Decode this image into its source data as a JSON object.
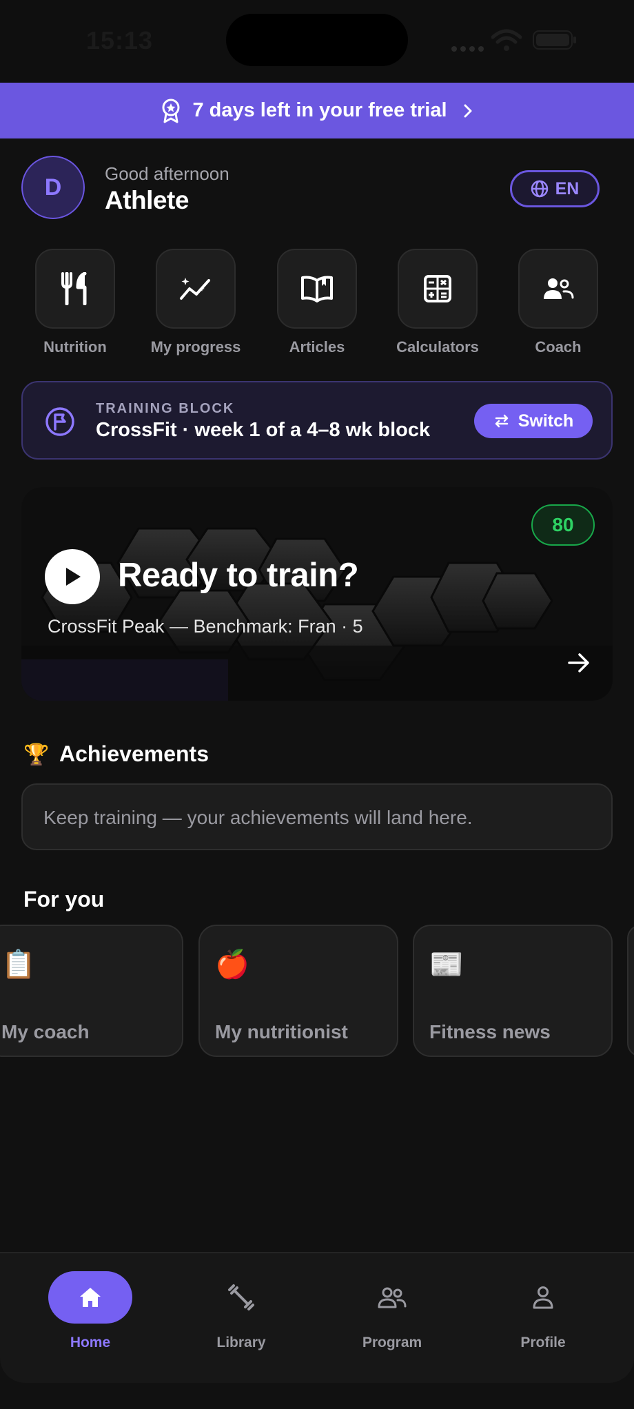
{
  "status_bar": {
    "time": "15:13"
  },
  "trial_banner": {
    "text": "7 days left in your free trial"
  },
  "greeting": {
    "avatar_letter": "D",
    "subtitle": "Good afternoon",
    "name": "Athlete",
    "language": "EN"
  },
  "quick_actions": [
    {
      "label": "Nutrition",
      "icon": "fork-knife-icon"
    },
    {
      "label": "My progress",
      "icon": "progress-chart-icon"
    },
    {
      "label": "Articles",
      "icon": "open-book-icon"
    },
    {
      "label": "Calculators",
      "icon": "calculator-icon"
    },
    {
      "label": "Coach",
      "icon": "coach-people-icon"
    }
  ],
  "training_block": {
    "label": "TRAINING BLOCK",
    "title": "CrossFit · week 1 of a 4–8 wk block",
    "button": "Switch"
  },
  "hero": {
    "score": "80",
    "title": "Ready to train?",
    "subtitle": "CrossFit Peak — Benchmark: Fran · 5"
  },
  "achievements": {
    "icon": "🏆",
    "title": "Achievements",
    "empty_text": "Keep training — your achievements will land here."
  },
  "for_you": {
    "title": "For you",
    "cards": [
      {
        "emoji": "📋",
        "label": "My coach"
      },
      {
        "emoji": "🍎",
        "label": "My nutritionist"
      },
      {
        "emoji": "📰",
        "label": "Fitness news"
      }
    ]
  },
  "tab_bar": {
    "home": "Home",
    "library": "Library",
    "program": "Program",
    "profile": "Profile",
    "active": "Home"
  },
  "colors": {
    "accent": "#7560f2",
    "banner": "#6b57e0",
    "score_green": "#2ed264",
    "background": "#111111"
  }
}
